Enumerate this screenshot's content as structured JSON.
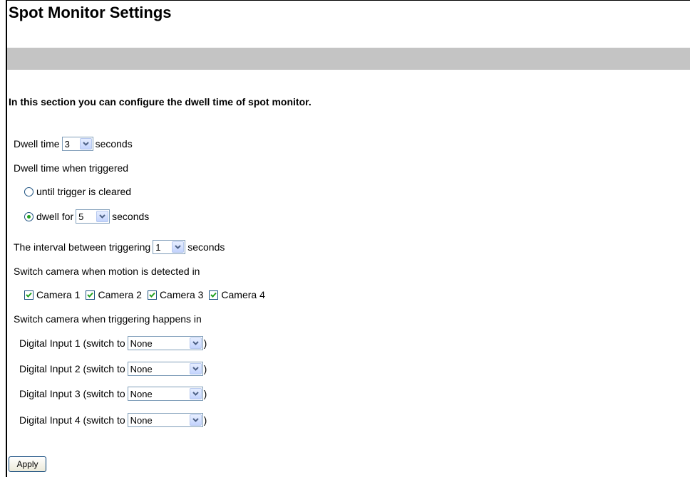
{
  "title": "Spot Monitor Settings",
  "intro": "In this section you can configure the dwell time of spot monitor.",
  "dwell": {
    "label": "Dwell time",
    "value": "3",
    "unit": "seconds"
  },
  "triggered": {
    "label": "Dwell time when triggered",
    "option_cleared": "until trigger is cleared",
    "option_dwell_label": "dwell for",
    "option_dwell_value": "5",
    "option_dwell_unit": "seconds",
    "selected": "dwell"
  },
  "interval": {
    "label": "The interval between triggering",
    "value": "1",
    "unit": "seconds"
  },
  "motion": {
    "label": "Switch camera when motion is detected in",
    "cameras": [
      {
        "label": "Camera 1",
        "checked": true
      },
      {
        "label": "Camera 2",
        "checked": true
      },
      {
        "label": "Camera 3",
        "checked": true
      },
      {
        "label": "Camera 4",
        "checked": true
      }
    ]
  },
  "trigger_switch": {
    "label": "Switch camera when triggering happens in",
    "inputs": [
      {
        "label": "Digital Input 1 (switch to",
        "value": "None",
        "close": ")"
      },
      {
        "label": "Digital Input 2 (switch to",
        "value": "None",
        "close": ")"
      },
      {
        "label": "Digital Input 3 (switch to",
        "value": "None",
        "close": ")"
      },
      {
        "label": "Digital Input 4 (switch to",
        "value": "None",
        "close": ")"
      }
    ]
  },
  "apply_label": "Apply",
  "colors": {
    "header_bar": "#c4c4c4",
    "control_border": "#7f9db9",
    "checkmark": "#21a121"
  }
}
